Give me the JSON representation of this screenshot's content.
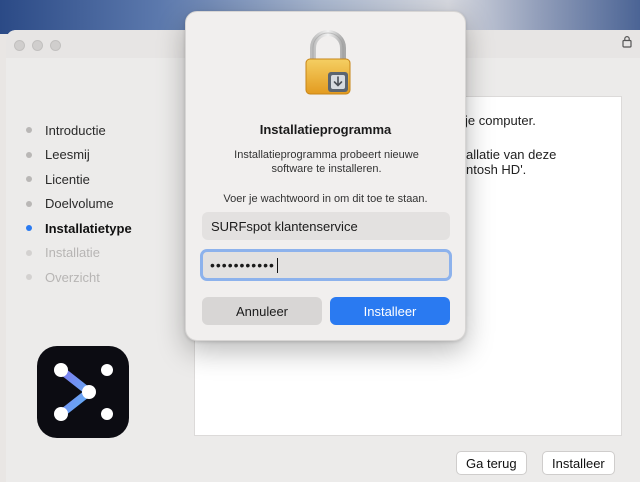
{
  "window": {
    "steps": [
      {
        "label": "Introductie",
        "state": "done"
      },
      {
        "label": "Leesmij",
        "state": "done"
      },
      {
        "label": "Licentie",
        "state": "done"
      },
      {
        "label": "Doelvolume",
        "state": "done"
      },
      {
        "label": "Installatietype",
        "state": "active"
      },
      {
        "label": "Installatie",
        "state": "pending"
      },
      {
        "label": "Overzicht",
        "state": "pending"
      }
    ],
    "content_lines": [
      "je computer.",
      "allatie van deze",
      "ntosh HD'."
    ],
    "back_label": "Ga terug",
    "install_label": "Installeer"
  },
  "dialog": {
    "title": "Installatieprogramma",
    "message": "Installatieprogramma probeert nieuwe software te installeren.",
    "prompt": "Voer je wachtwoord in om dit toe te staan.",
    "username_value": "SURFspot klantenservice",
    "password_mask": "•••••••••••",
    "cancel_label": "Annuleer",
    "install_label": "Installeer"
  },
  "icons": [
    "padlock-icon",
    "lock-icon",
    "app-icon"
  ],
  "colors": {
    "accent": "#2a7af1",
    "focus_ring": "#8db2ec"
  }
}
